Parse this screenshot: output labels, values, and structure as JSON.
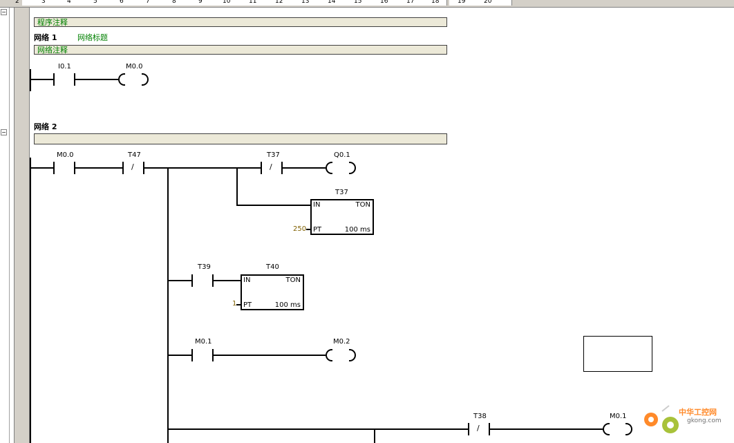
{
  "ruler": {
    "labels": [
      "2",
      "3",
      "4",
      "5",
      "6",
      "7",
      "8",
      "9",
      "10",
      "11",
      "12",
      "13",
      "14",
      "15",
      "16",
      "17",
      "18",
      "19",
      "20"
    ]
  },
  "program_comment": "程序注释",
  "network1": {
    "label": "网络 1",
    "title": "网络标题",
    "comment": "网络注释",
    "contact_i01": "I0.1",
    "coil_m00": "M0.0"
  },
  "network2": {
    "label": "网络 2",
    "comment": "",
    "contact_m00": "M0.0",
    "contact_t47": "T47",
    "contact_t37": "T37",
    "coil_q01": "Q0.1",
    "timer_t37": {
      "name": "T37",
      "in": "IN",
      "type": "TON",
      "pt": "PT",
      "base": "100 ms",
      "preset": "250"
    },
    "contact_t39": "T39",
    "timer_t40": {
      "name": "T40",
      "in": "IN",
      "type": "TON",
      "pt": "PT",
      "base": "100 ms",
      "preset": "1"
    },
    "contact_m01": "M0.1",
    "coil_m02": "M0.2",
    "contact_t38": "T38",
    "coil_m01": "M0.1",
    "nc_symbol": "/"
  },
  "watermark": {
    "title": "中华工控网",
    "url": "gkong.com"
  },
  "colors": {
    "comment_bg": "#ece9d8",
    "comment_text": "#008000",
    "preset_text": "#806000",
    "watermark": "#ff8a2a"
  }
}
